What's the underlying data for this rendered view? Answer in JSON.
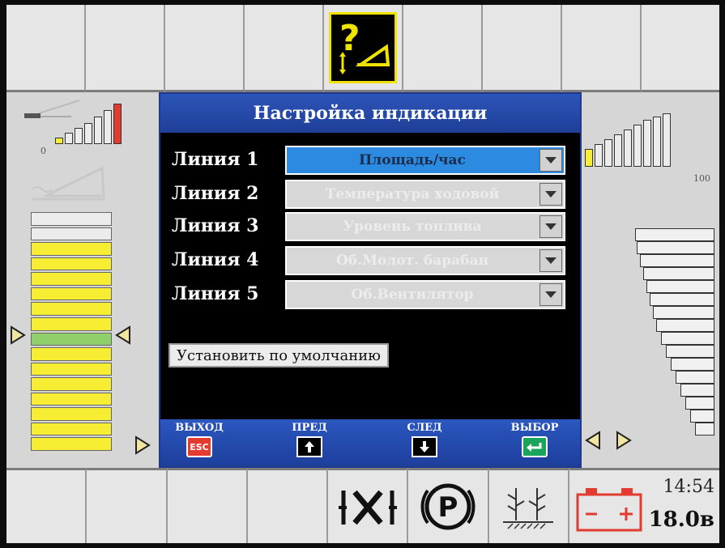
{
  "dialog": {
    "title": "Настройка индикации",
    "lines": [
      {
        "label": "Линия 1",
        "value": "Площадь/час",
        "active": true
      },
      {
        "label": "Линия 2",
        "value": "Температура ходовой",
        "active": false
      },
      {
        "label": "Линия 3",
        "value": "Уровень топлива",
        "active": false
      },
      {
        "label": "Линия 4",
        "value": "Об.Молот. барабан",
        "active": false
      },
      {
        "label": "Линия 5",
        "value": "Об.Вентилятор",
        "active": false
      }
    ],
    "default_button": "Установить по умолчанию"
  },
  "footer": {
    "exit": {
      "label": "ВЫХОД",
      "key": "ESC"
    },
    "prev": {
      "label": "ПРЕД"
    },
    "next": {
      "label": "СЛЕД"
    },
    "select": {
      "label": "ВЫБОР"
    }
  },
  "left_gauge": {
    "min_label": "0"
  },
  "right_gauge": {
    "max_label": "100"
  },
  "status": {
    "time": "14:54",
    "voltage": "18.0в"
  },
  "icons": {
    "top_warning": "header-tilt-warning-icon",
    "differential_lock": "differential-lock-icon",
    "parking": "parking-brake-icon",
    "crop": "crop-field-icon",
    "battery": "battery-icon"
  },
  "colors": {
    "dialog_bg": "#000000",
    "title_bar": "#2c54b8",
    "active_select": "#2c8ae0",
    "warning_yellow": "#f1e300",
    "battery_red": "#e33b2f",
    "esc_red": "#e33b2f",
    "enter_green": "#1aa55a"
  }
}
